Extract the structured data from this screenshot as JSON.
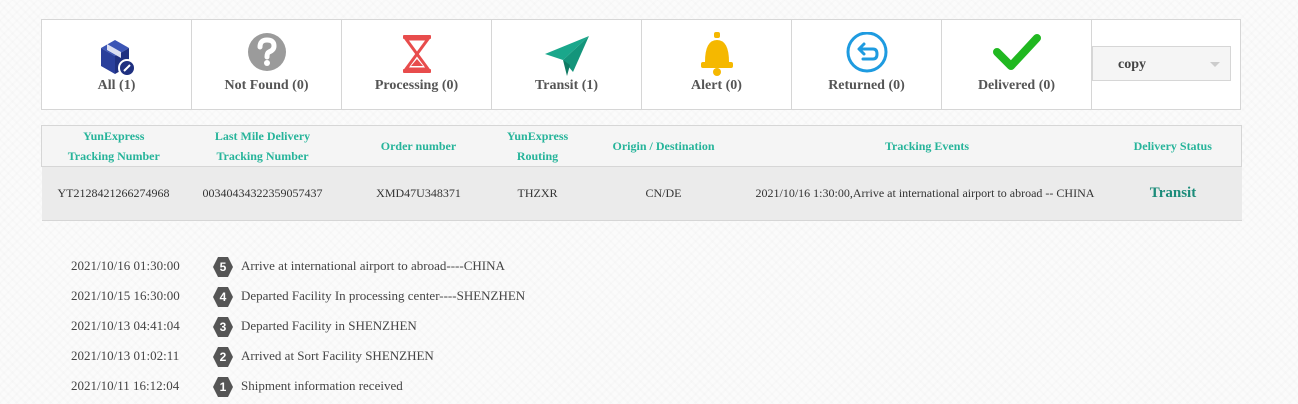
{
  "status_tabs": [
    {
      "label": "All (1)",
      "icon": "package-icon"
    },
    {
      "label": "Not Found (0)",
      "icon": "question-icon"
    },
    {
      "label": "Processing (0)",
      "icon": "hourglass-icon"
    },
    {
      "label": "Transit (1)",
      "icon": "paper-plane-icon"
    },
    {
      "label": "Alert (0)",
      "icon": "bell-icon"
    },
    {
      "label": "Returned (0)",
      "icon": "return-arrow-icon"
    },
    {
      "label": "Delivered (0)",
      "icon": "checkmark-icon"
    }
  ],
  "copy_select": {
    "value": "copy"
  },
  "table": {
    "headers": [
      [
        "YunExpress",
        "Tracking Number"
      ],
      [
        "Last Mile Delivery",
        "Tracking Number"
      ],
      [
        "Order number"
      ],
      [
        "YunExpress",
        "Routing"
      ],
      [
        "Origin / Destination"
      ],
      [
        "Tracking Events"
      ],
      [
        "Delivery Status"
      ]
    ],
    "row": {
      "tracking_number": "YT2128421266274968",
      "last_mile_number": "00340434322359057437",
      "order_number": "XMD47U348371",
      "routing": "THZXR",
      "origin_destination": "CN/DE",
      "tracking_event": "2021/10/16 1:30:00,Arrive at international airport to abroad -- CHINA",
      "delivery_status": "Transit"
    }
  },
  "events": [
    {
      "time": "2021/10/16 01:30:00",
      "num": "5",
      "desc": "Arrive at international airport to abroad----CHINA"
    },
    {
      "time": "2021/10/15 16:30:00",
      "num": "4",
      "desc": "Departed Facility In processing center----SHENZHEN"
    },
    {
      "time": "2021/10/13 04:41:04",
      "num": "3",
      "desc": "Departed Facility in SHENZHEN"
    },
    {
      "time": "2021/10/13 01:02:11",
      "num": "2",
      "desc": "Arrived at Sort Facility SHENZHEN"
    },
    {
      "time": "2021/10/11 16:12:04",
      "num": "1",
      "desc": "Shipment information received"
    }
  ],
  "colors": {
    "accent_teal": "#26b49a",
    "transit_status": "#1c8c7a",
    "package_blue": "#2a3f9b",
    "hourglass_red": "#e84c4c",
    "plane_teal": "#1aa78b",
    "bell_yellow": "#f5b800",
    "return_blue": "#1e9be0",
    "check_green": "#20b820",
    "badge_dark": "#555555"
  }
}
